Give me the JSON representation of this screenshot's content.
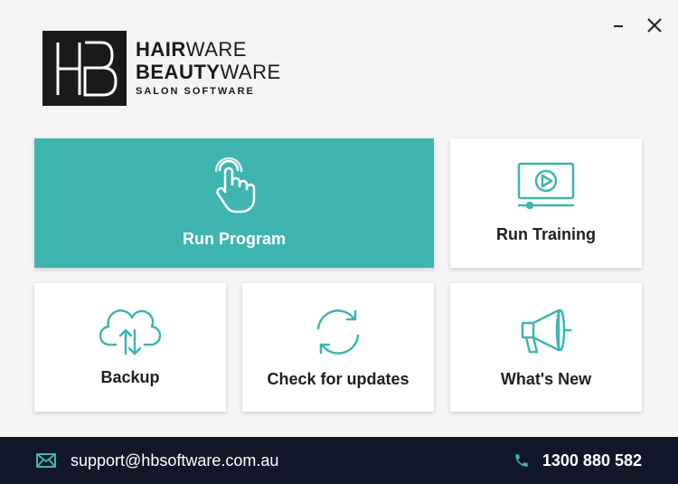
{
  "window": {
    "minimize_icon": "minimize-icon",
    "close_icon": "close-icon"
  },
  "logo": {
    "line1_bold": "HAIR",
    "line1_light": "WARE",
    "line2_bold": "BEAUTY",
    "line2_light": "WARE",
    "tagline": "SALON SOFTWARE",
    "mark": "HB"
  },
  "tiles": {
    "run_program": {
      "label": "Run Program",
      "icon": "pointer-hand-icon"
    },
    "run_training": {
      "label": "Run Training",
      "icon": "video-play-icon"
    },
    "backup": {
      "label": "Backup",
      "icon": "cloud-sync-icon"
    },
    "check_updates": {
      "label": "Check for updates",
      "icon": "refresh-icon"
    },
    "whats_new": {
      "label": "What's New",
      "icon": "megaphone-icon"
    }
  },
  "footer": {
    "email": "support@hbsoftware.com.au",
    "phone": "1300 880 582"
  },
  "colors": {
    "accent": "#3fb5af",
    "footer_bg": "#111629",
    "background": "#f4f4f4"
  }
}
